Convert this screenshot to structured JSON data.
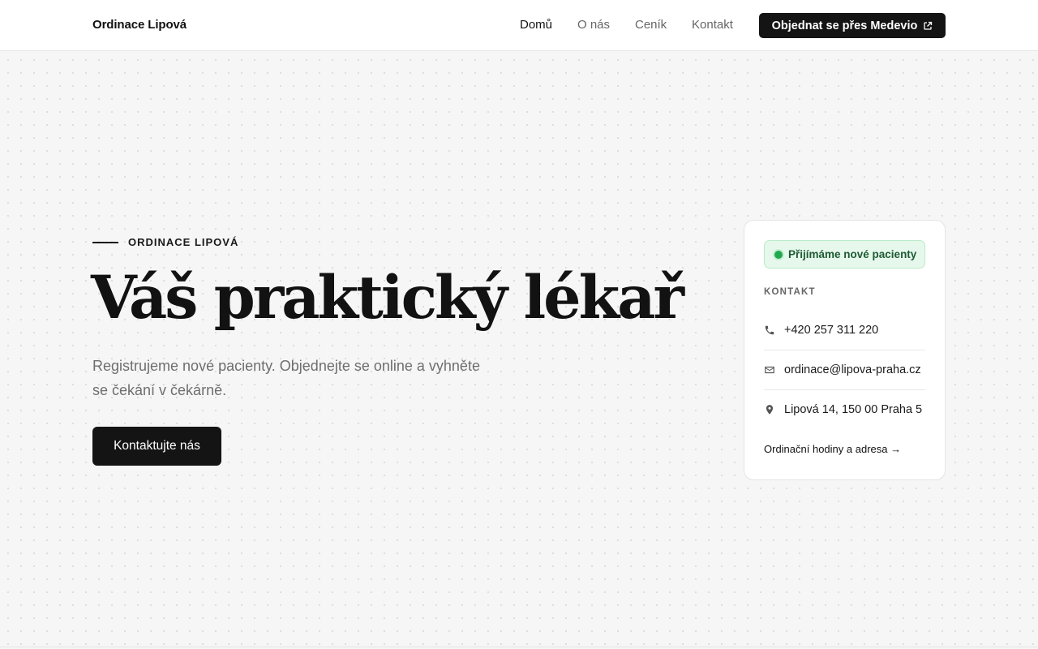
{
  "header": {
    "brand": "Ordinace Lipová",
    "nav": [
      {
        "label": "Domů",
        "active": true
      },
      {
        "label": "O nás",
        "active": false
      },
      {
        "label": "Ceník",
        "active": false
      },
      {
        "label": "Kontakt",
        "active": false
      }
    ],
    "cta_label": "Objednat se přes Medevio",
    "cta_icon": "external-link-icon"
  },
  "hero": {
    "eyebrow": "ORDINACE LIPOVÁ",
    "title": "Váš praktický lékař",
    "lead": "Registrujeme nové pacienty. Objednejte se online a vyhněte se čekání v čekárně.",
    "cta_label": "Kontaktujte nás"
  },
  "card": {
    "badge": "Přijímáme nové pacienty",
    "section_label": "KONTAKT",
    "phone": "+420 257 311 220",
    "email": "ordinace@lipova-praha.cz",
    "address": "Lipová 14, 150 00 Praha 5",
    "link": "Ordinační hodiny a adresa →"
  },
  "colors": {
    "primary": "#141414",
    "background": "#f6f6f6",
    "badge_bg": "#e6f8ec",
    "badge_dot": "#22a84e",
    "muted_text": "#6e6e6e"
  }
}
